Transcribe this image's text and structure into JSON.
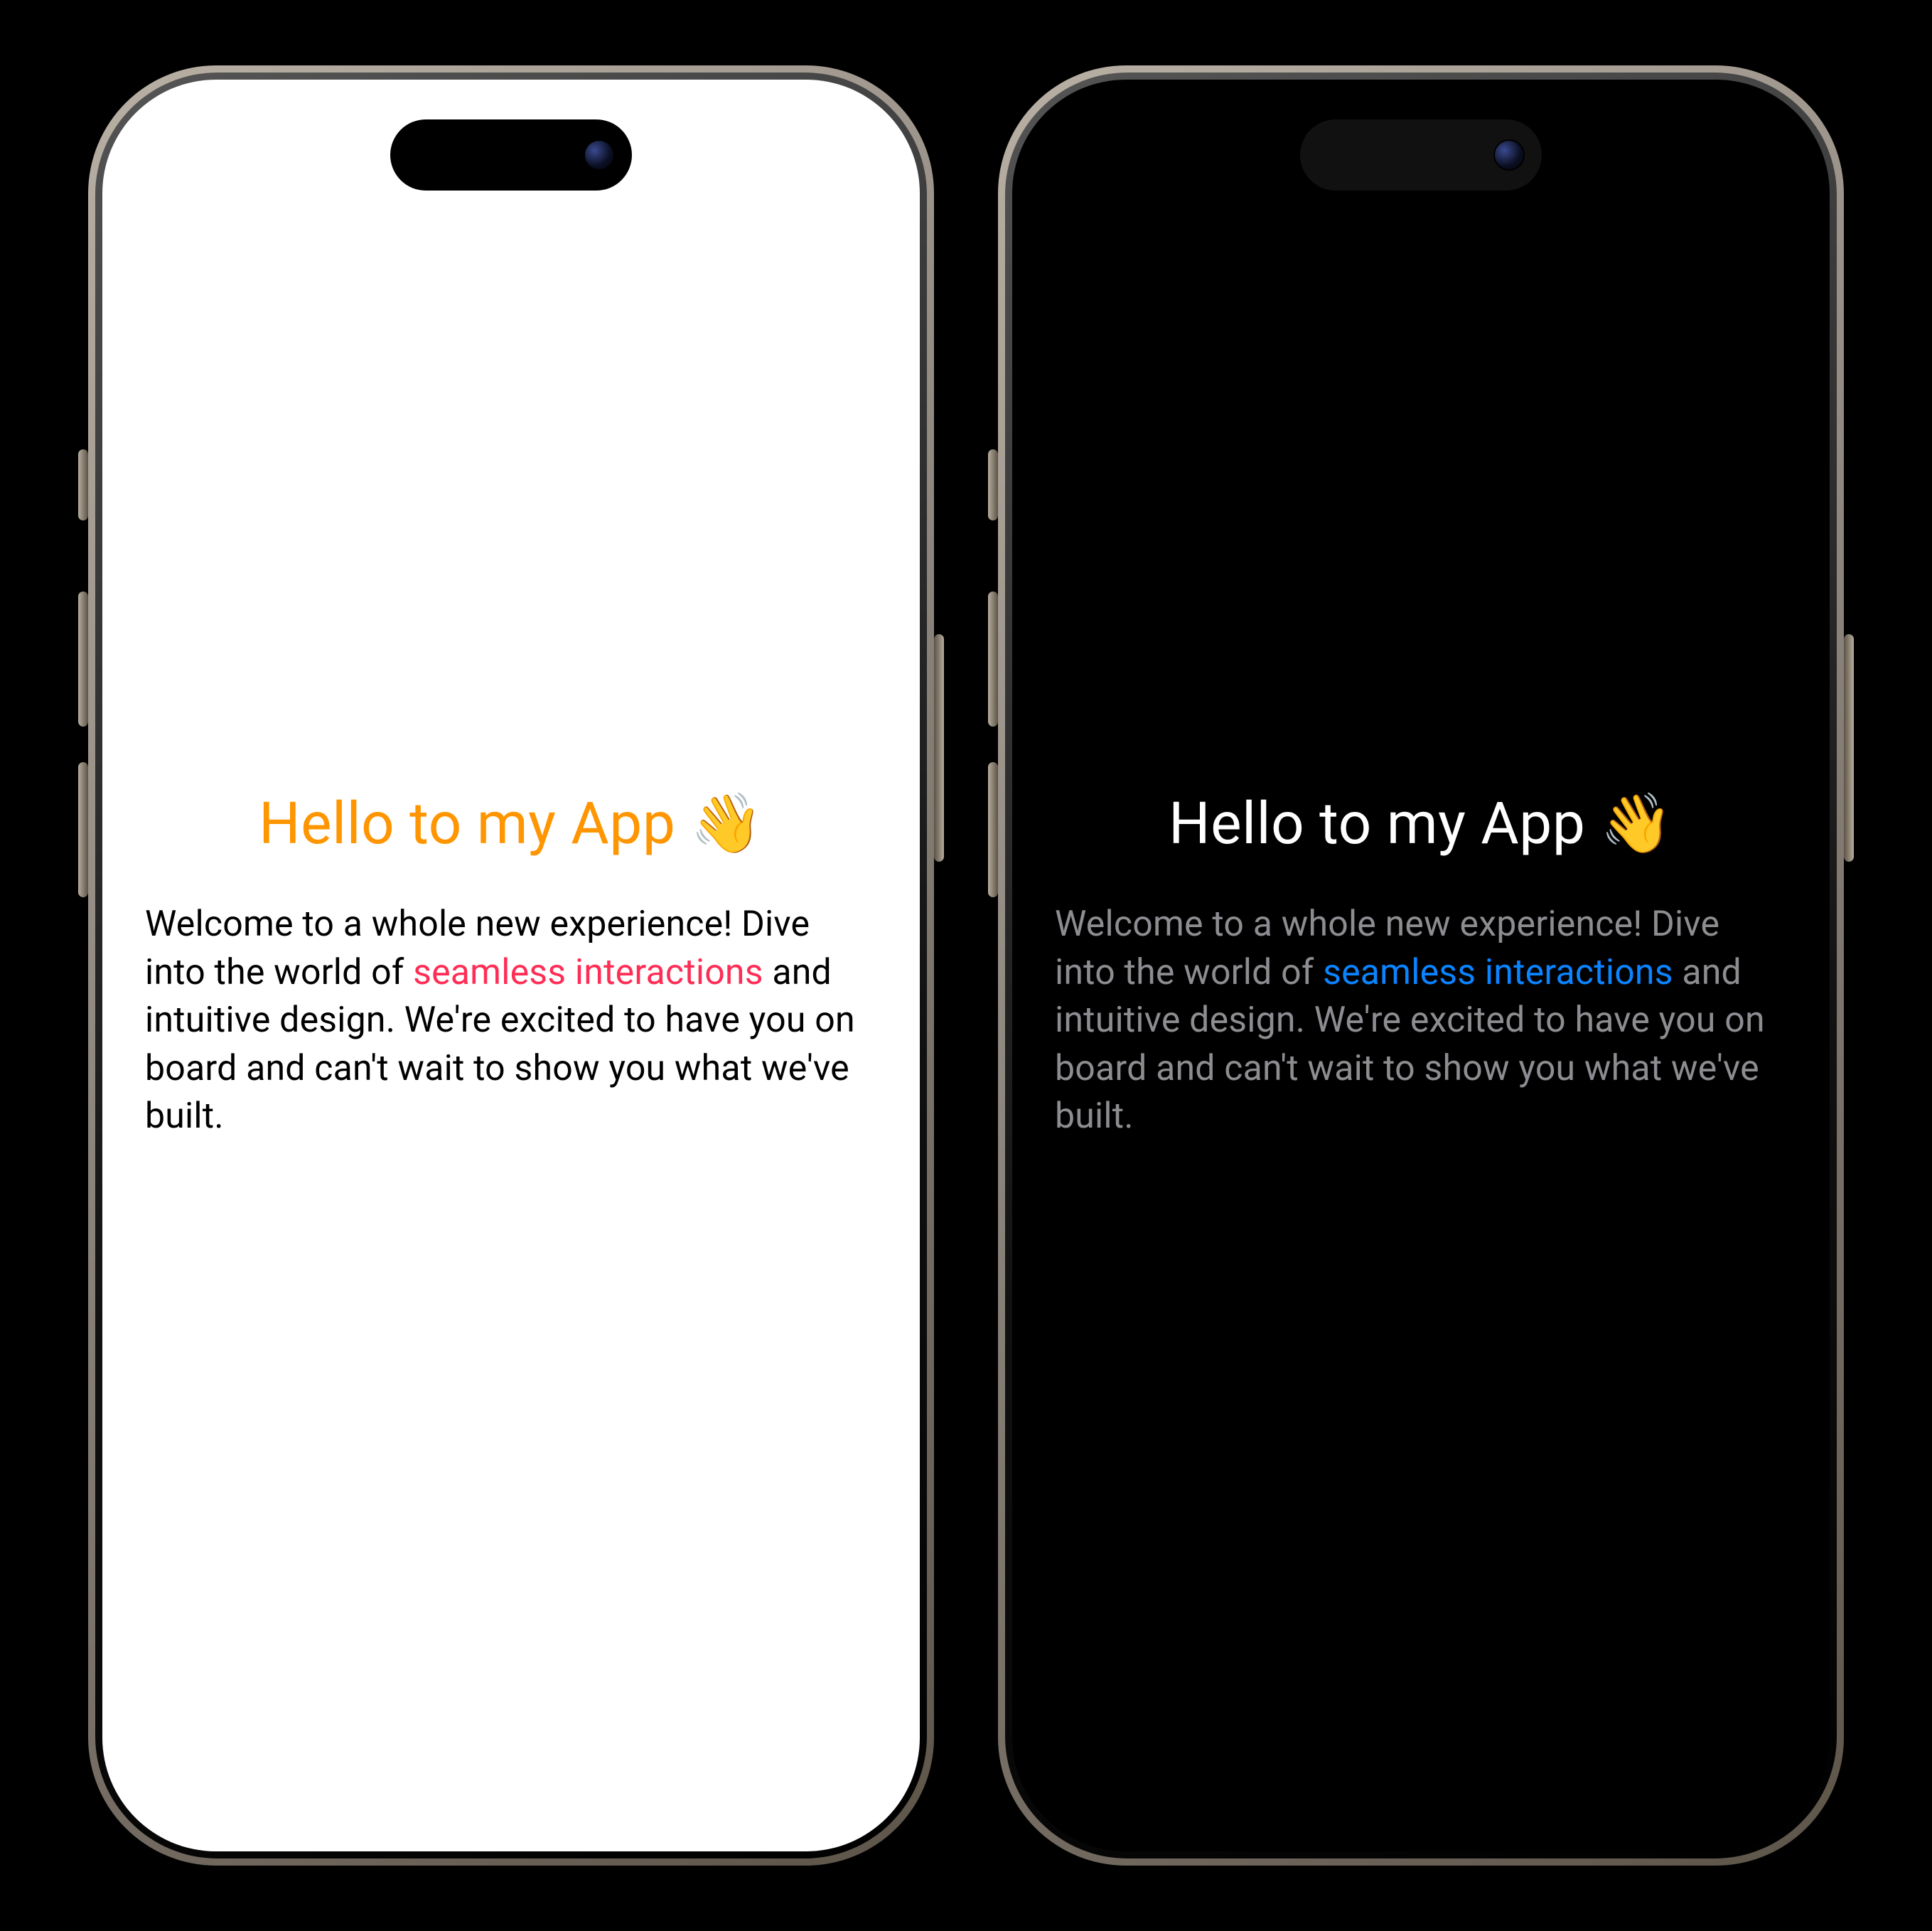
{
  "headline_text": "Hello to my App",
  "headline_emoji": "👋",
  "body": {
    "pre": "Welcome to a whole new experience! Dive into the world of ",
    "highlight": "seamless interactions",
    "post": " and intuitive design. We're excited to have you on board and can't wait to show you what we've built."
  },
  "colors": {
    "light": {
      "headline": "#ff9500",
      "highlight": "#ff2d55",
      "text": "#000000",
      "bg": "#ffffff"
    },
    "dark": {
      "headline": "#ffffff",
      "highlight": "#0a84ff",
      "text": "#8d8d91",
      "bg": "#000000"
    }
  }
}
